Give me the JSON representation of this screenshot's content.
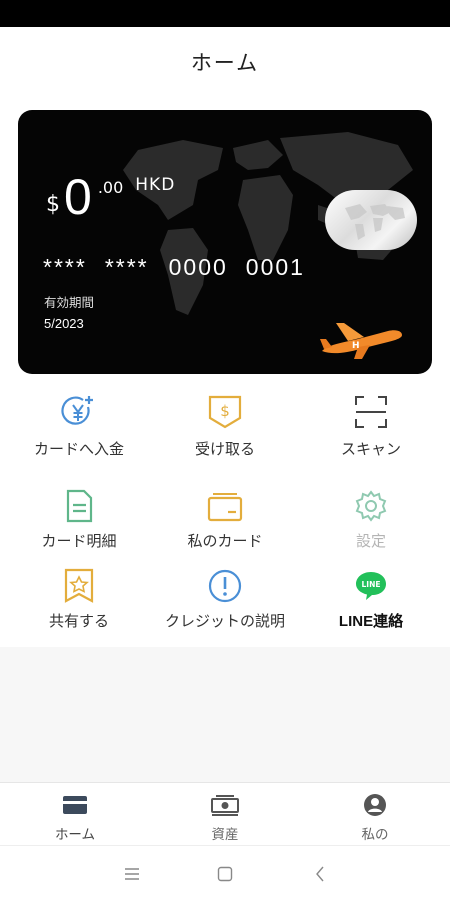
{
  "header": {
    "title": "ホーム"
  },
  "card": {
    "currency_symbol": "$",
    "amount": "0",
    "cents": ".00",
    "currency": "HKD",
    "number_groups": [
      "****",
      "****",
      "0000",
      "0001"
    ],
    "expiry_label": "有効期間",
    "expiry_value": "5/2023"
  },
  "actions": [
    {
      "label": "カードへ入金",
      "icon": "yen-plus-icon"
    },
    {
      "label": "受け取る",
      "icon": "dollar-receive-icon"
    },
    {
      "label": "スキャン",
      "icon": "scan-icon"
    },
    {
      "label": "カード明細",
      "icon": "document-icon"
    },
    {
      "label": "私のカード",
      "icon": "wallet-card-icon"
    },
    {
      "label": "設定",
      "icon": "gear-icon"
    },
    {
      "label": "共有する",
      "icon": "share-star-icon"
    },
    {
      "label": "クレジットの説明",
      "icon": "info-icon"
    },
    {
      "label": "LINE連絡",
      "icon": "line-icon"
    }
  ],
  "line_badge": "LINE",
  "tabs": [
    {
      "label": "ホーム",
      "icon": "card-icon"
    },
    {
      "label": "資産",
      "icon": "money-icon"
    },
    {
      "label": "私の",
      "icon": "user-icon"
    }
  ],
  "colors": {
    "blue": "#4a8fd6",
    "gold": "#e3ad3c",
    "green": "#5fb68a",
    "line_green": "#22c05a",
    "plane_orange": "#f28a2a"
  }
}
